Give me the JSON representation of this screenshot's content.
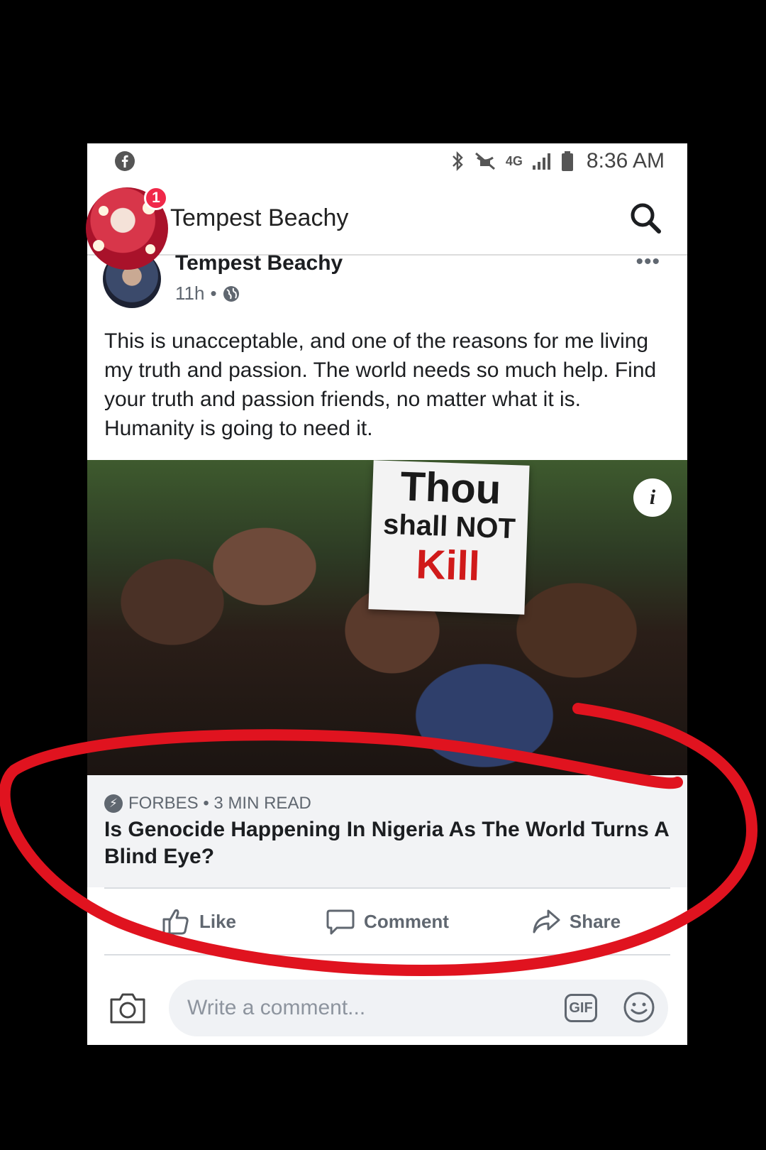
{
  "statusbar": {
    "network": "4G",
    "time": "8:36 AM"
  },
  "header": {
    "title": "Tempest Beachy",
    "notification_count": "1"
  },
  "post": {
    "author": "Tempest Beachy",
    "time": "11h",
    "separator": "•",
    "more": "•••",
    "text": "This is unacceptable, and one of the reasons for me living my truth and passion. The world needs so much help. Find your truth and passion friends, no matter what it is. Humanity is going to need it.",
    "image_sign": {
      "line1": "Thou",
      "line2": "shall NOT",
      "line3": "Kill"
    },
    "info": "i",
    "link": {
      "source": "FORBES • 3 MIN READ",
      "headline": "Is Genocide Happening In Nigeria As The World Turns A Blind Eye?"
    }
  },
  "actions": {
    "like": "Like",
    "comment": "Comment",
    "share": "Share"
  },
  "comment_bar": {
    "placeholder": "Write a comment...",
    "gif": "GIF"
  },
  "colors": {
    "accent_red": "#e0131f",
    "badge_red": "#f02849",
    "text_secondary": "#606770"
  }
}
